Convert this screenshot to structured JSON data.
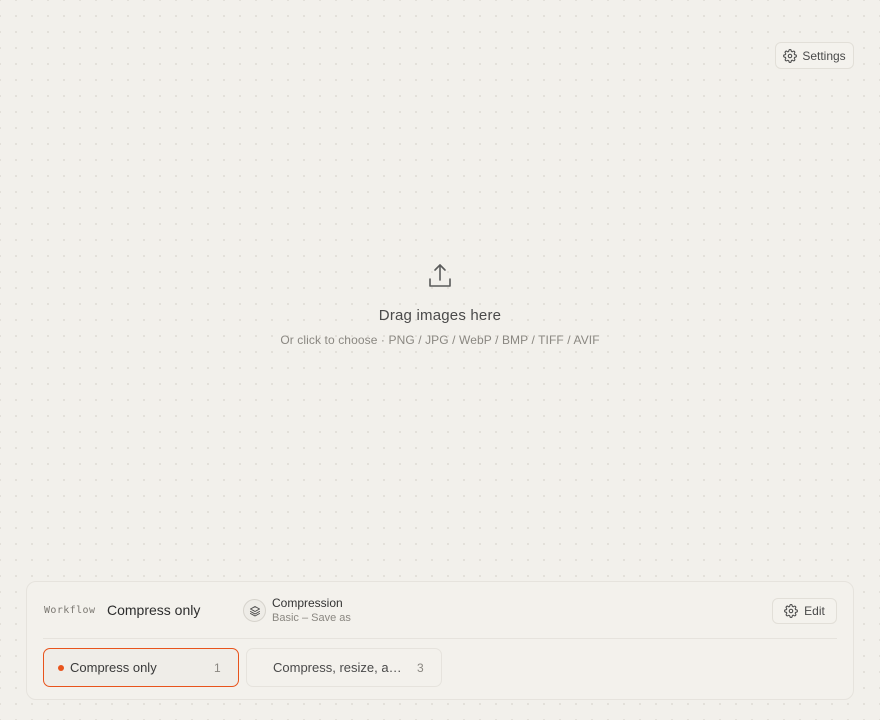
{
  "header": {
    "settings_label": "Settings",
    "settings_icon": "gear-icon"
  },
  "drop_zone": {
    "icon": "upload-icon",
    "title": "Drag images here",
    "subtitle": "Or click to choose · PNG / JPG / WebP / BMP / TIFF / AVIF"
  },
  "workflow": {
    "label": "Workflow",
    "name": "Compress only",
    "stage": {
      "icon": "layers-icon",
      "title": "Compression",
      "subtitle": "Basic – Save as"
    },
    "edit_label": "Edit",
    "presets": [
      {
        "label": "Compress only",
        "count": "1",
        "active": true
      },
      {
        "label": "Compress, resize, a…",
        "count": "3",
        "active": false
      }
    ]
  },
  "colors": {
    "accent": "#e8541c",
    "background": "#f2f0eb"
  }
}
